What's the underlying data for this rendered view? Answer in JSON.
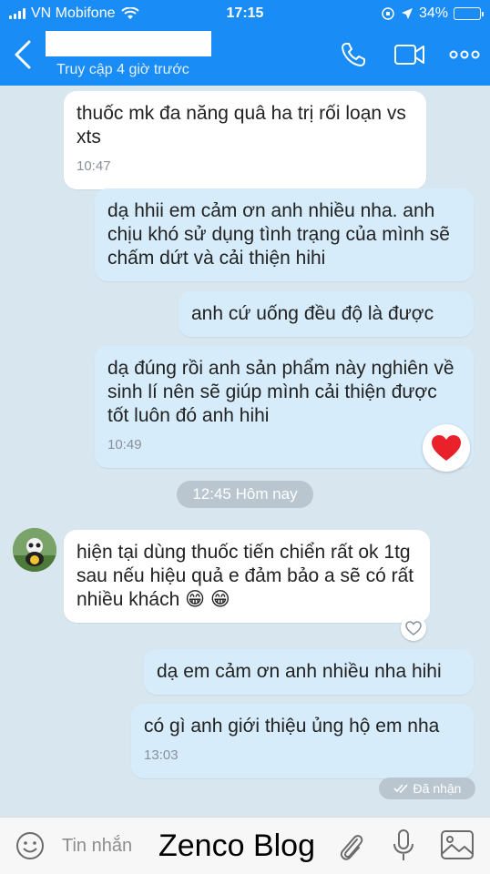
{
  "status_bar": {
    "carrier": "VN Mobifone",
    "time": "17:15",
    "battery": "34%",
    "battery_level": 0.34
  },
  "header": {
    "subtitle": "Truy cập 4 giờ trước",
    "icons": [
      "back-chevron-icon",
      "phone-icon",
      "video-icon",
      "more-icon"
    ]
  },
  "messages": [
    {
      "side": "in",
      "text": "thuốc mk đa năng quâ ha trị rối loạn vs xts",
      "time": "10:47"
    },
    {
      "side": "out",
      "text": "dạ hhii em cảm ơn anh nhiều nha. anh chịu khó sử dụng tình trạng của mình sẽ  chấm dứt và cải thiện hihi"
    },
    {
      "side": "in",
      "text": "anh cứ uống đều độ   là được"
    },
    {
      "side": "out",
      "text": "dạ đúng rồi anh sản phẩm này  nghiên về sinh lí  nên sẽ giúp mình cải thiện được tốt luôn đó anh hihi",
      "time": "10:49"
    },
    {
      "side": "in",
      "text": "hiện tại dùng thuốc tiến chiển rất ok 1tg sau nếu hiệu quả e đảm bảo a sẽ có rất nhiều khách 😁 😁"
    },
    {
      "side": "out",
      "text": "dạ em cảm ơn anh nhiều nha hihi"
    },
    {
      "side": "out",
      "text": "có gì anh giới thiệu ủng hộ em nha",
      "time": "13:03"
    }
  ],
  "date_separator": "12:45 Hôm nay",
  "seen_label": "Đã nhận",
  "composer": {
    "placeholder": "Tin nhắn",
    "watermark": "Zenco Blog"
  },
  "colors": {
    "header_blue": "#1a8cf5",
    "chat_bg": "#d8e6ef",
    "outgoing_bubble": "#d6ecfb",
    "incoming_bubble": "#ffffff",
    "heart_red": "#e8212b"
  }
}
